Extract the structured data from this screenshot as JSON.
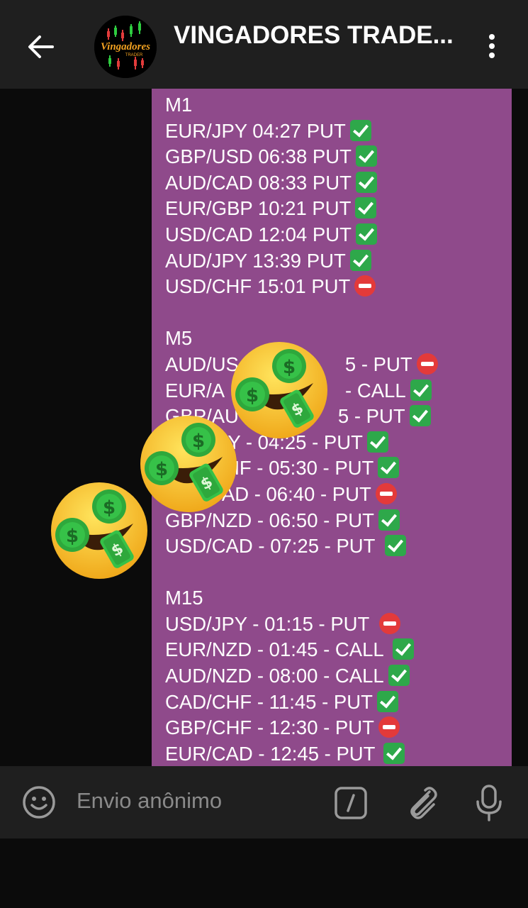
{
  "header": {
    "title": "VINGADORES TRADE...",
    "avatar_text": "Vingadores",
    "avatar_sub": "TRADER"
  },
  "message": {
    "sections": [
      {
        "heading": "M1",
        "entries": [
          {
            "text": "EUR/JPY 04:27 PUT",
            "result": "check"
          },
          {
            "text": "GBP/USD 06:38 PUT",
            "result": "check"
          },
          {
            "text": "AUD/CAD 08:33 PUT",
            "result": "check"
          },
          {
            "text": "EUR/GBP 10:21 PUT",
            "result": "check"
          },
          {
            "text": "USD/CAD 12:04 PUT",
            "result": "check"
          },
          {
            "text": "AUD/JPY 13:39 PUT",
            "result": "check"
          },
          {
            "text": "USD/CHF 15:01 PUT",
            "result": "no-entry"
          }
        ]
      },
      {
        "heading": "M5",
        "entries": [
          {
            "text": "AUD/US",
            "text_tail": "5 - PUT",
            "result": "no-entry"
          },
          {
            "text": "EUR/A",
            "text_tail": "- CALL",
            "result": "check"
          },
          {
            "text": "GBP/AU",
            "text_tail": "5 - PUT",
            "result": "check"
          },
          {
            "text": "",
            "text_tail": "PY - 04:25 - PUT",
            "result": "check"
          },
          {
            "text": "",
            "text_tail": "HF - 05:30 - PUT",
            "result": "check"
          },
          {
            "text": "",
            "text_tail": "CAD - 06:40 - PUT",
            "result": "no-entry"
          },
          {
            "text": "GBP/NZD - 06:50 - PUT",
            "result": "check"
          },
          {
            "text": "USD/CAD - 07:25 - PUT",
            "result": "check"
          }
        ]
      },
      {
        "heading": "M15",
        "entries": [
          {
            "text": "USD/JPY - 01:15 - PUT",
            "result": "no-entry"
          },
          {
            "text": "EUR/NZD - 01:45 - CALL",
            "result": "check"
          },
          {
            "text": "AUD/NZD - 08:00 - CALL",
            "result": "check"
          },
          {
            "text": "CAD/CHF - 11:45 - PUT",
            "result": "check"
          },
          {
            "text": "GBP/CHF - 12:30 - PUT",
            "result": "no-entry"
          },
          {
            "text": "EUR/CAD - 12:45 - PUT",
            "result": "check"
          }
        ]
      }
    ]
  },
  "overlay": {
    "emoji_name": "money-mouth-face-icon",
    "count": 3
  },
  "input": {
    "placeholder": "Envio anônimo"
  },
  "icons": {
    "back": "arrow-left-icon",
    "menu": "more-vertical-icon",
    "emoji": "smiley-icon",
    "commands": "slash-command-icon",
    "attach": "paperclip-icon",
    "mic": "microphone-icon"
  },
  "colors": {
    "bubble": "#8f4a8b",
    "header": "#1f1f1f",
    "check": "#2ea84a",
    "no_entry": "#e33a3a"
  }
}
